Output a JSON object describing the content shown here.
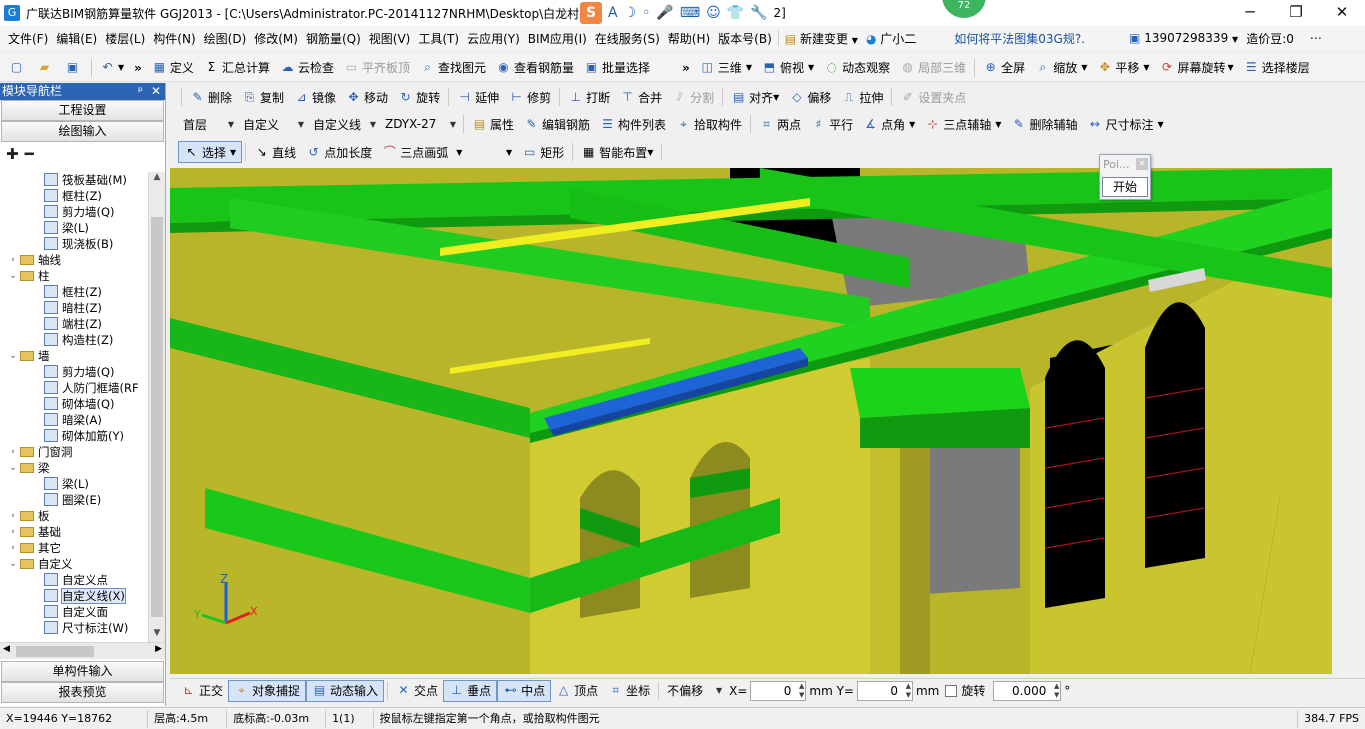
{
  "titlebar": {
    "title": "广联达BIM钢筋算量软件 GGJ2013 - [C:\\Users\\Administrator.PC-20141127NRHM\\Desktop\\白龙村-",
    "title_tail": "2]",
    "badge": "72",
    "window_buttons": [
      "─",
      "❐",
      "✕"
    ]
  },
  "menubar": {
    "items": [
      "文件(F)",
      "编辑(E)",
      "楼层(L)",
      "构件(N)",
      "绘图(D)",
      "修改(M)",
      "钢筋量(Q)",
      "视图(V)",
      "工具(T)",
      "云应用(Y)",
      "BIM应用(I)",
      "在线服务(S)",
      "帮助(H)",
      "版本号(B)"
    ],
    "new_change": "新建变更",
    "assistant": "广小二",
    "help_link": "如何将平法图集03G规?.",
    "phone": "13907298339",
    "beans": "造价豆:0"
  },
  "toolbar1": {
    "items": [
      {
        "icon": "▦",
        "label": "定义"
      },
      {
        "icon": "Σ",
        "label": "汇总计算"
      },
      {
        "icon": "☁",
        "label": "云检查"
      },
      {
        "icon": "▭",
        "label": "平齐板顶",
        "disabled": true
      },
      {
        "icon": "⌕",
        "label": "查找图元"
      },
      {
        "icon": "◉",
        "label": "查看钢筋量"
      },
      {
        "icon": "▣",
        "label": "批量选择"
      }
    ],
    "right_items": [
      {
        "icon": "◫",
        "label": "三维"
      },
      {
        "icon": "⬒",
        "label": "俯视"
      },
      {
        "icon": "◌",
        "label": "动态观察"
      },
      {
        "icon": "◍",
        "label": "局部三维",
        "disabled": true
      },
      {
        "icon": "⊕",
        "label": "全屏"
      },
      {
        "icon": "⌕",
        "label": "缩放"
      },
      {
        "icon": "✥",
        "label": "平移"
      },
      {
        "icon": "⟳",
        "label": "屏幕旋转"
      },
      {
        "icon": "☰",
        "label": "选择楼层"
      }
    ]
  },
  "toolbar2": {
    "items": [
      {
        "icon": "✎",
        "label": "删除"
      },
      {
        "icon": "⎘",
        "label": "复制"
      },
      {
        "icon": "⊿",
        "label": "镜像"
      },
      {
        "icon": "✥",
        "label": "移动"
      },
      {
        "icon": "↻",
        "label": "旋转"
      },
      {
        "icon": "⊣",
        "label": "延伸"
      },
      {
        "icon": "⊢",
        "label": "修剪"
      },
      {
        "icon": "⊥",
        "label": "打断"
      },
      {
        "icon": "⊤",
        "label": "合并"
      },
      {
        "icon": "⫽",
        "label": "分割",
        "disabled": true
      },
      {
        "icon": "▤",
        "label": "对齐"
      },
      {
        "icon": "◇",
        "label": "偏移"
      },
      {
        "icon": "⎍",
        "label": "拉伸"
      },
      {
        "icon": "✐",
        "label": "设置夹点",
        "disabled": true
      }
    ]
  },
  "toolbar3": {
    "floor": "首层",
    "category": "自定义",
    "type": "自定义线",
    "component": "ZDYX-27",
    "items": [
      {
        "icon": "▤",
        "label": "属性"
      },
      {
        "icon": "✎",
        "label": "编辑钢筋"
      },
      {
        "icon": "☰",
        "label": "构件列表"
      },
      {
        "icon": "⌖",
        "label": "拾取构件"
      },
      {
        "icon": "⌗",
        "label": "两点"
      },
      {
        "icon": "♯",
        "label": "平行"
      },
      {
        "icon": "∡",
        "label": "点角"
      },
      {
        "icon": "⊹",
        "label": "三点辅轴"
      },
      {
        "icon": "✎",
        "label": "删除辅轴"
      },
      {
        "icon": "↔",
        "label": "尺寸标注"
      }
    ]
  },
  "toolbar4": {
    "select": "选择",
    "items": [
      {
        "icon": "↘",
        "label": "直线"
      },
      {
        "icon": "↺",
        "label": "点加长度"
      },
      {
        "icon": "⌒",
        "label": "三点画弧"
      },
      {
        "icon": "▭",
        "label": "矩形"
      },
      {
        "icon": "▦",
        "label": "智能布置"
      }
    ]
  },
  "nav": {
    "header": "模块导航栏",
    "pin": "ᵖ",
    "close": "✕",
    "tab_setup": "工程设置",
    "tab_draw": "绘图输入",
    "tools": [
      "✚",
      "━"
    ],
    "tree": [
      {
        "level": 2,
        "label": "筏板基础(M)"
      },
      {
        "level": 2,
        "label": "框柱(Z)"
      },
      {
        "level": 2,
        "label": "剪力墙(Q)"
      },
      {
        "level": 2,
        "label": "梁(L)"
      },
      {
        "level": 2,
        "label": "现浇板(B)"
      },
      {
        "level": 1,
        "label": "轴线",
        "folder": true,
        "exp": "›"
      },
      {
        "level": 1,
        "label": "柱",
        "folder": true,
        "exp": "⌄"
      },
      {
        "level": 2,
        "label": "框柱(Z)"
      },
      {
        "level": 2,
        "label": "暗柱(Z)"
      },
      {
        "level": 2,
        "label": "端柱(Z)"
      },
      {
        "level": 2,
        "label": "构造柱(Z)"
      },
      {
        "level": 1,
        "label": "墙",
        "folder": true,
        "exp": "⌄"
      },
      {
        "level": 2,
        "label": "剪力墙(Q)"
      },
      {
        "level": 2,
        "label": "人防门框墙(RF"
      },
      {
        "level": 2,
        "label": "砌体墙(Q)"
      },
      {
        "level": 2,
        "label": "暗梁(A)"
      },
      {
        "level": 2,
        "label": "砌体加筋(Y)"
      },
      {
        "level": 1,
        "label": "门窗洞",
        "folder": true,
        "exp": "›"
      },
      {
        "level": 1,
        "label": "梁",
        "folder": true,
        "exp": "⌄"
      },
      {
        "level": 2,
        "label": "梁(L)"
      },
      {
        "level": 2,
        "label": "圈梁(E)"
      },
      {
        "level": 1,
        "label": "板",
        "folder": true,
        "exp": "›"
      },
      {
        "level": 1,
        "label": "基础",
        "folder": true,
        "exp": "›"
      },
      {
        "level": 1,
        "label": "其它",
        "folder": true,
        "exp": "›"
      },
      {
        "level": 1,
        "label": "自定义",
        "folder": true,
        "exp": "⌄"
      },
      {
        "level": 2,
        "label": "自定义点"
      },
      {
        "level": 2,
        "label": "自定义线(X)",
        "selected": true
      },
      {
        "level": 2,
        "label": "自定义面"
      },
      {
        "level": 2,
        "label": "尺寸标注(W)"
      }
    ],
    "single_input": "单构件输入",
    "report": "报表预览"
  },
  "popup": {
    "title": "Poi...",
    "close": "×",
    "start": "开始"
  },
  "snapbar": {
    "items": [
      {
        "icon": "⊾",
        "label": "正交"
      },
      {
        "icon": "⌖",
        "label": "对象捕捉",
        "active": true
      },
      {
        "icon": "▤",
        "label": "动态输入",
        "active": true
      },
      {
        "icon": "✕",
        "label": "交点"
      },
      {
        "icon": "⊥",
        "label": "垂点",
        "active": true
      },
      {
        "icon": "⊷",
        "label": "中点",
        "active": true
      },
      {
        "icon": "△",
        "label": "顶点"
      },
      {
        "icon": "⌗",
        "label": "坐标"
      }
    ],
    "offset_mode": "不偏移",
    "x_label": "X=",
    "x_value": "0",
    "y_label": "mm Y=",
    "y_value": "0",
    "unit": "mm",
    "rotate_label": "旋转",
    "rotate_value": "0.000",
    "degree": "°"
  },
  "status": {
    "coords": "X=19446 Y=18762",
    "floor_height": "层高:4.5m",
    "bottom_height": "底标高:-0.03m",
    "count": "1(1)",
    "hint": "按鼠标左键指定第一个角点，或拾取构件图元",
    "fps": "384.7 FPS"
  },
  "axes": {
    "z": "Z",
    "x": "X",
    "y": "Y"
  }
}
